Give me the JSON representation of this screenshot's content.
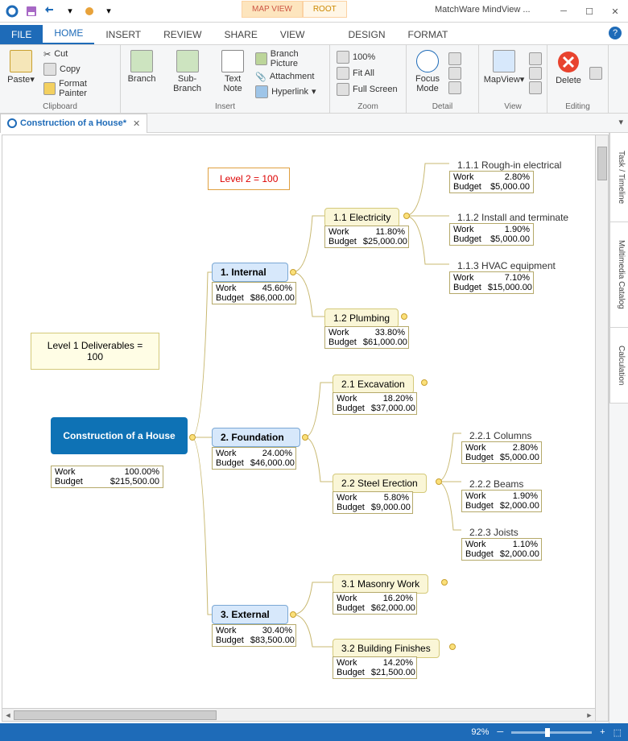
{
  "app": {
    "title": "MatchWare MindView ..."
  },
  "context_tabs": {
    "a": "MAP VIEW",
    "b": "ROOT"
  },
  "tabs": {
    "file": "FILE",
    "home": "HOME",
    "insert": "INSERT",
    "review": "REVIEW",
    "share": "SHARE",
    "view": "VIEW",
    "design": "DESIGN",
    "format": "FORMAT"
  },
  "ribbon": {
    "clipboard": {
      "label": "Clipboard",
      "paste": "Paste",
      "cut": "Cut",
      "copy": "Copy",
      "fp": "Format Painter"
    },
    "insert": {
      "label": "Insert",
      "branch": "Branch",
      "sub": "Sub-Branch",
      "tn": "Text\nNote",
      "bp": "Branch Picture",
      "att": "Attachment",
      "hl": "Hyperlink"
    },
    "zoom": {
      "label": "Zoom",
      "z100": "100%",
      "fit": "Fit All",
      "fs": "Full Screen"
    },
    "detail": {
      "label": "Detail",
      "focus": "Focus\nMode"
    },
    "view": {
      "label": "View",
      "mv": "MapView"
    },
    "editing": {
      "label": "Editing",
      "del": "Delete"
    }
  },
  "doc": {
    "tab": "Construction of a House*"
  },
  "sidetabs": {
    "a": "Task / Timeline",
    "b": "Multimedia Catalog",
    "c": "Calculation"
  },
  "annot": {
    "l1": "Level 1 Deliverables = 100",
    "l2": "Level 2 = 100"
  },
  "map": {
    "root": {
      "title": "Construction of a House",
      "work": "100.00%",
      "budget": "$215,500.00"
    },
    "n1": {
      "title": "1.  Internal",
      "work": "45.60%",
      "budget": "$86,000.00"
    },
    "n11": {
      "title": "1.1  Electricity",
      "work": "11.80%",
      "budget": "$25,000.00"
    },
    "n111": {
      "title": "1.1.1  Rough-in electrical",
      "work": "2.80%",
      "budget": "$5,000.00"
    },
    "n112": {
      "title": "1.1.2  Install and terminate",
      "work": "1.90%",
      "budget": "$5,000.00"
    },
    "n113": {
      "title": "1.1.3   HVAC equipment",
      "work": "7.10%",
      "budget": "$15,000.00"
    },
    "n12": {
      "title": "1.2  Plumbing",
      "work": "33.80%",
      "budget": "$61,000.00"
    },
    "n2": {
      "title": "2.  Foundation",
      "work": "24.00%",
      "budget": "$46,000.00"
    },
    "n21": {
      "title": "2.1  Excavation",
      "work": "18.20%",
      "budget": "$37,000.00"
    },
    "n22": {
      "title": "2.2  Steel Erection",
      "work": "5.80%",
      "budget": "$9,000.00"
    },
    "n221": {
      "title": "2.2.1  Columns",
      "work": "2.80%",
      "budget": "$5,000.00"
    },
    "n222": {
      "title": "2.2.2  Beams",
      "work": "1.90%",
      "budget": "$2,000.00"
    },
    "n223": {
      "title": "2.2.3  Joists",
      "work": "1.10%",
      "budget": "$2,000.00"
    },
    "n3": {
      "title": "3.  External",
      "work": "30.40%",
      "budget": "$83,500.00"
    },
    "n31": {
      "title": "3.1  Masonry Work",
      "work": "16.20%",
      "budget": "$62,000.00"
    },
    "n32": {
      "title": "3.2  Building Finishes",
      "work": "14.20%",
      "budget": "$21,500.00"
    }
  },
  "labels": {
    "work": "Work",
    "budget": "Budget"
  },
  "status": {
    "zoom": "92%"
  }
}
